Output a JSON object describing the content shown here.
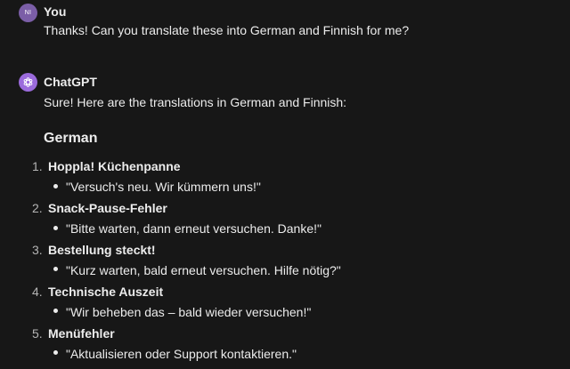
{
  "user_message": {
    "avatar_initials": "NI",
    "author": "You",
    "text": "Thanks! Can you translate these into German and Finnish for me?"
  },
  "assistant_message": {
    "author": "ChatGPT",
    "intro": "Sure! Here are the translations in German and Finnish:",
    "section_heading": "German",
    "items": [
      {
        "number": "1.",
        "title": "Hoppla! Küchenpanne",
        "sub": "\"Versuch's neu. Wir kümmern uns!\""
      },
      {
        "number": "2.",
        "title": "Snack-Pause-Fehler",
        "sub": "\"Bitte warten, dann erneut versuchen. Danke!\""
      },
      {
        "number": "3.",
        "title": "Bestellung steckt!",
        "sub": "\"Kurz warten, bald erneut versuchen. Hilfe nötig?\""
      },
      {
        "number": "4.",
        "title": "Technische Auszeit",
        "sub": "\"Wir beheben das – bald wieder versuchen!\""
      },
      {
        "number": "5.",
        "title": "Menüfehler",
        "sub": "\"Aktualisieren oder Support kontaktieren.\""
      }
    ]
  },
  "colors": {
    "background": "#171717",
    "text": "#ececec",
    "user_avatar": "#7b5ea7",
    "assistant_avatar": "#9b6bdc"
  }
}
